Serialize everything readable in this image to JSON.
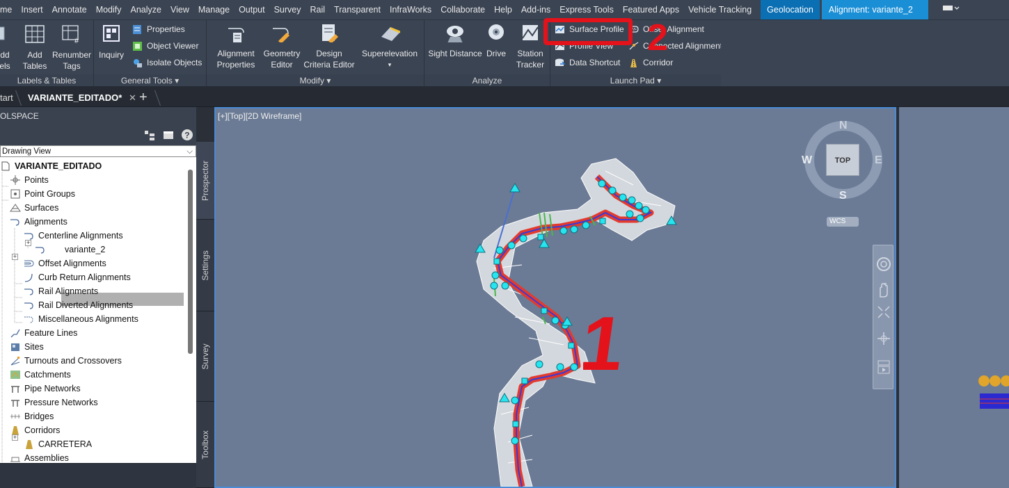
{
  "menu": {
    "items": [
      "me",
      "Insert",
      "Annotate",
      "Modify",
      "Analyze",
      "View",
      "Manage",
      "Output",
      "Survey",
      "Rail",
      "Transparent",
      "InfraWorks",
      "Collaborate",
      "Help",
      "Add-ins",
      "Express Tools",
      "Featured Apps",
      "Vehicle Tracking"
    ],
    "active": "Geolocation",
    "context": "Alignment: variante_2"
  },
  "ribbon": {
    "labels_tables": {
      "add_labels": [
        "dd",
        "els"
      ],
      "add_tables": [
        "Add",
        "Tables"
      ],
      "renumber": [
        "Renumber",
        "Tags"
      ],
      "title": "Labels & Tables"
    },
    "general_tools": {
      "inquiry": "Inquiry",
      "properties": "Properties",
      "object_viewer": "Object Viewer",
      "isolate": "Isolate Objects",
      "title": "General Tools"
    },
    "modify": {
      "alignment_props": [
        "Alignment",
        "Properties"
      ],
      "geometry_editor": [
        "Geometry",
        "Editor"
      ],
      "design_criteria": [
        "Design",
        "Criteria Editor"
      ],
      "superelevation": "Superelevation",
      "title": "Modify"
    },
    "analyze": {
      "sight_distance": "Sight Distance",
      "drive": "Drive",
      "station_tracker": [
        "Station",
        "Tracker"
      ],
      "title": "Analyze"
    },
    "launch_pad": {
      "surface_profile": "Surface Profile",
      "profile_view": "Profile View",
      "data_shortcut": "Data Shortcut",
      "offset_alignment": "Offset Alignment",
      "connected_alignment": "Connected Alignment",
      "corridor": "Corridor",
      "title": "Launch Pad"
    }
  },
  "tabs": {
    "start": "tart",
    "drawing": "VARIANTE_EDITADO*"
  },
  "toolspace": {
    "title": "OLSPACE",
    "view": "Drawing View",
    "tree": [
      {
        "label": "VARIANTE_EDITADO",
        "bold": true
      },
      {
        "label": "Points"
      },
      {
        "label": "Point Groups"
      },
      {
        "label": "Surfaces"
      },
      {
        "label": "Alignments"
      },
      {
        "label": "Centerline Alignments"
      },
      {
        "label": "variante_2"
      },
      {
        "label": "Offset Alignments"
      },
      {
        "label": "Curb Return Alignments"
      },
      {
        "label": "Rail Alignments"
      },
      {
        "label": "Rail Diverted Alignments"
      },
      {
        "label": "Miscellaneous Alignments"
      },
      {
        "label": "Feature Lines"
      },
      {
        "label": "Sites"
      },
      {
        "label": "Turnouts and Crossovers"
      },
      {
        "label": "Catchments"
      },
      {
        "label": "Pipe Networks"
      },
      {
        "label": "Pressure Networks"
      },
      {
        "label": "Bridges"
      },
      {
        "label": "Corridors"
      },
      {
        "label": "CARRETERA"
      },
      {
        "label": "Assemblies"
      }
    ],
    "side_tabs": [
      "Prospector",
      "Settings",
      "Survey",
      "Toolbox"
    ]
  },
  "viewport": {
    "label": "[+][Top][2D Wireframe]",
    "viewcube": {
      "n": "N",
      "s": "S",
      "e": "E",
      "w": "W",
      "top": "TOP",
      "wcs": "WCS"
    },
    "annotations": {
      "one": "1",
      "two": "2"
    }
  },
  "colors": {
    "menubar": "#3b4453",
    "active_tab": "#0a6fb3",
    "viewport_bg": "#6b7b95",
    "alignment": "#e23b2e",
    "markers": "#27e5ef",
    "annotation_red": "#e4121b"
  }
}
